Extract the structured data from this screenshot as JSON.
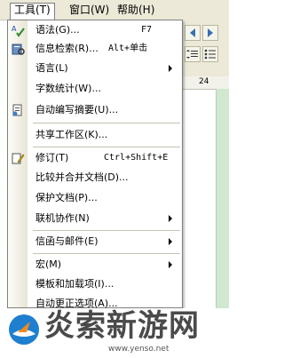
{
  "menubar": {
    "items": [
      {
        "label": "工具(T)"
      },
      {
        "label": "窗口(W)"
      },
      {
        "label": "帮助(H)"
      }
    ]
  },
  "ruler": {
    "tick": "24"
  },
  "menu": {
    "items": [
      {
        "label": "语法(G)...",
        "shortcut": "F7"
      },
      {
        "label": "信息检索(R)...",
        "shortcut": "Alt+单击"
      },
      {
        "label": "语言(L)",
        "submenu": true
      },
      {
        "label": "字数统计(W)..."
      },
      {
        "label": "自动编写摘要(U)..."
      },
      {
        "label": "共享工作区(K)..."
      },
      {
        "label": "修订(T)",
        "shortcut": "Ctrl+Shift+E"
      },
      {
        "label": "比较并合并文档(D)..."
      },
      {
        "label": "保护文档(P)..."
      },
      {
        "label": "联机协作(N)",
        "submenu": true
      },
      {
        "label": "信函与邮件(E)",
        "submenu": true
      },
      {
        "label": "宏(M)",
        "submenu": true
      },
      {
        "label": "模板和加载项(I)..."
      },
      {
        "label": "自动更正选项(A)..."
      }
    ]
  },
  "watermark": {
    "text": "炎索新游网",
    "url": "www.yenso.net"
  },
  "colors": {
    "menubar_bg": "#ece9d8",
    "menu_bg": "#ffffff",
    "gutter": "#e8e5d6",
    "watermark_blue": "#1e7fd0"
  }
}
